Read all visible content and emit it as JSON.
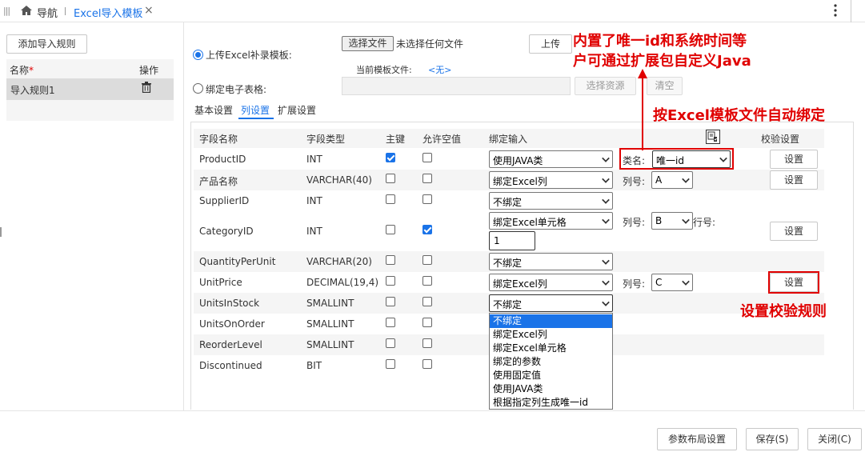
{
  "topbar": {
    "nav_label": "导航",
    "tab_label": "Excel导入模板",
    "close_symbol": "×"
  },
  "left": {
    "add_rule_button": "添加导入规则",
    "col_name": "名称",
    "col_op": "操作",
    "rule_name": "导入规则1"
  },
  "upload": {
    "radio_upload_label": "上传Excel补录模板:",
    "choose_file_button": "选择文件",
    "no_file_text": "未选择任何文件",
    "upload_button": "上传",
    "current_template_label": "当前模板文件:",
    "current_template_value": "<无>",
    "radio_bind_label": "绑定电子表格:",
    "choose_resource_button": "选择资源",
    "clear_button": "清空"
  },
  "tabs": [
    "基本设置",
    "列设置",
    "扩展设置"
  ],
  "table": {
    "headers": {
      "field_name": "字段名称",
      "field_type": "字段类型",
      "primary_key": "主键",
      "allow_null": "允许空值",
      "bind_input": "绑定输入",
      "validation": "校验设置"
    },
    "rows": [
      {
        "name": "ProductID",
        "type": "INT",
        "pk": true,
        "nullable": false,
        "bind": "使用JAVA类",
        "extra_label": "类名:",
        "extra_value": "唯一id",
        "has_setting": true
      },
      {
        "name": "产品名称",
        "type": "VARCHAR(40)",
        "pk": false,
        "nullable": false,
        "bind": "绑定Excel列",
        "extra_label": "列号:",
        "extra_value": "A",
        "has_setting": true
      },
      {
        "name": "SupplierID",
        "type": "INT",
        "pk": false,
        "nullable": false,
        "bind": "不绑定"
      },
      {
        "name": "CategoryID",
        "type": "INT",
        "pk": false,
        "nullable": true,
        "bind": "绑定Excel单元格",
        "extra_label": "列号:",
        "extra_value": "B",
        "extra_label2": "行号:",
        "row_input": "1",
        "has_setting": true
      },
      {
        "name": "QuantityPerUnit",
        "type": "VARCHAR(20)",
        "pk": false,
        "nullable": false,
        "bind": "不绑定"
      },
      {
        "name": "UnitPrice",
        "type": "DECIMAL(19,4)",
        "pk": false,
        "nullable": false,
        "bind": "绑定Excel列",
        "extra_label": "列号:",
        "extra_value": "C",
        "has_setting": true
      },
      {
        "name": "UnitsInStock",
        "type": "SMALLINT",
        "pk": false,
        "nullable": false,
        "bind": "不绑定"
      },
      {
        "name": "UnitsOnOrder",
        "type": "SMALLINT",
        "pk": false,
        "nullable": false
      },
      {
        "name": "ReorderLevel",
        "type": "SMALLINT",
        "pk": false,
        "nullable": false
      },
      {
        "name": "Discontinued",
        "type": "BIT",
        "pk": false,
        "nullable": false
      }
    ],
    "setting_button": "设置"
  },
  "dropdown_options": [
    "不绑定",
    "绑定Excel列",
    "绑定Excel单元格",
    "绑定的参数",
    "使用固定值",
    "使用JAVA类",
    "根据指定列生成唯一id"
  ],
  "annotations": {
    "note1_line1": "内置了唯一id和系统时间等",
    "note1_line2": "户可通过扩展包自定义Java",
    "note2": "按Excel模板文件自动绑定",
    "note3": "设置校验规则"
  },
  "footer": {
    "param_layout_button": "参数布局设置",
    "save_button": "保存(S)",
    "close_button": "关闭(C)"
  }
}
